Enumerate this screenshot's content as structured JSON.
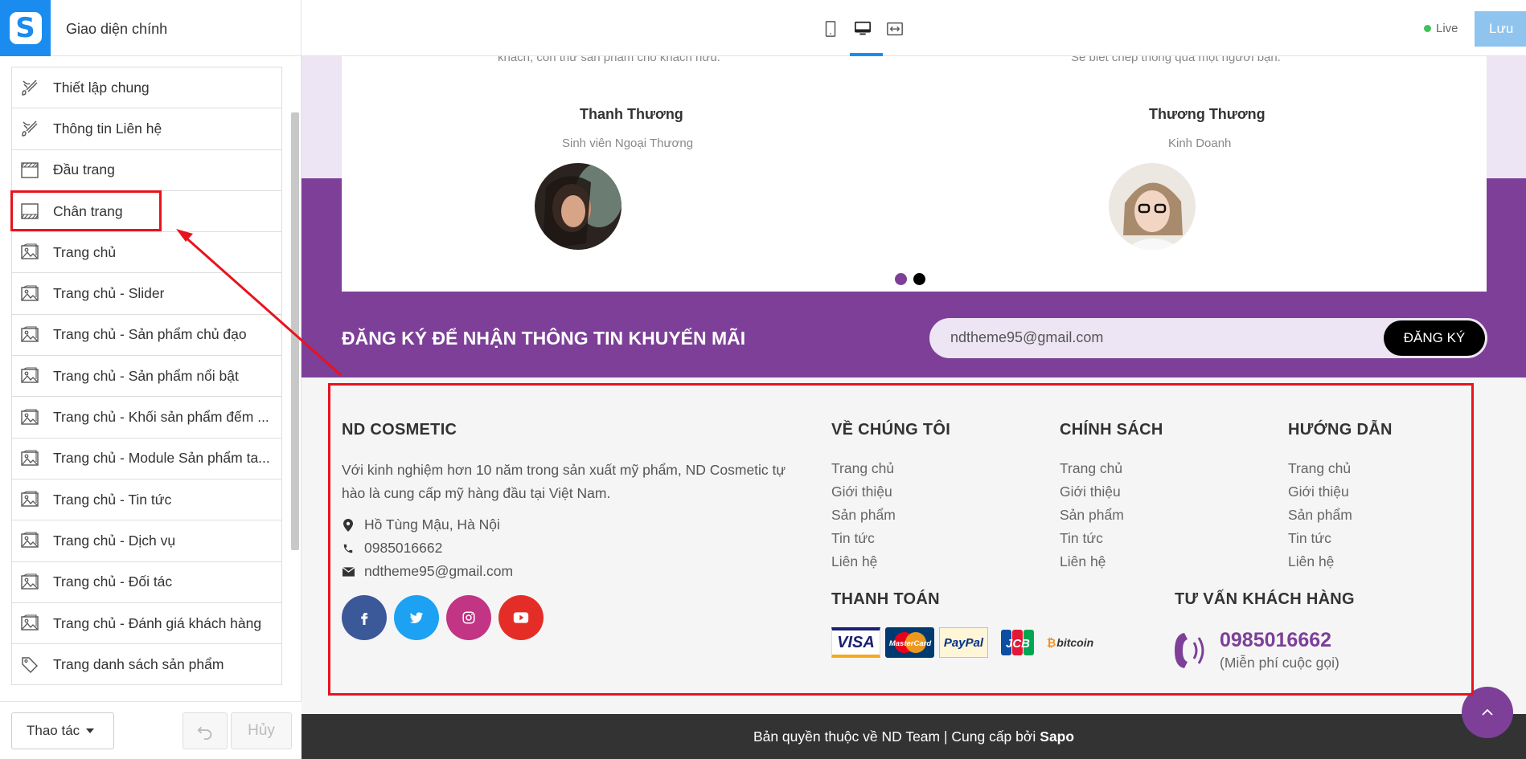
{
  "topbar": {
    "title": "Giao diện chính",
    "logo_letter": "S",
    "devices": [
      "mobile-icon",
      "desktop-icon",
      "fullwidth-icon"
    ],
    "active_device": "desktop",
    "live_label": "Live",
    "save_label": "Lưu"
  },
  "sidebar": {
    "items": [
      {
        "label": "Thiết lập chung",
        "icon": "brush-icon"
      },
      {
        "label": "Thông tin Liên hệ",
        "icon": "brush-icon"
      },
      {
        "label": "Đầu trang",
        "icon": "header-icon"
      },
      {
        "label": "Chân trang",
        "icon": "footer-icon"
      },
      {
        "label": "Trang chủ",
        "icon": "image-icon"
      },
      {
        "label": "Trang chủ - Slider",
        "icon": "image-icon"
      },
      {
        "label": "Trang chủ - Sản phẩm chủ đạo",
        "icon": "image-icon"
      },
      {
        "label": "Trang chủ - Sản phẩm nổi bật",
        "icon": "image-icon"
      },
      {
        "label": "Trang chủ - Khối sản phẩm đếm ...",
        "icon": "image-icon"
      },
      {
        "label": "Trang chủ - Module Sản phẩm ta...",
        "icon": "image-icon"
      },
      {
        "label": "Trang chủ - Tin tức",
        "icon": "image-icon"
      },
      {
        "label": "Trang chủ - Dịch vụ",
        "icon": "image-icon"
      },
      {
        "label": "Trang chủ - Đối tác",
        "icon": "image-icon"
      },
      {
        "label": "Trang chủ - Đánh giá khách hàng",
        "icon": "image-icon"
      },
      {
        "label": "Trang danh sách sản phẩm",
        "icon": "tag-icon"
      }
    ],
    "highlighted_item": "Chân trang",
    "action_label": "Thao tác",
    "cancel_label": "Hủy"
  },
  "preview": {
    "testimonials": {
      "cut_text_left": "khách, còn thử sản phẩm cho khách hữu.",
      "cut_text_right": "Sẽ biết chép thông qua một người bạn.",
      "people": [
        {
          "name": "Thanh Thương",
          "role": "Sinh viên Ngoại Thương"
        },
        {
          "name": "Thương Thương",
          "role": "Kinh Doanh"
        }
      ],
      "active_dot": 1
    },
    "newsletter": {
      "title": "ĐĂNG KÝ ĐỂ NHẬN THÔNG TIN KHUYẾN MÃI",
      "email_value": "ndtheme95@gmail.com",
      "button_label": "ĐĂNG KÝ"
    },
    "footer": {
      "brand": "ND COSMETIC",
      "description": "Với kinh nghiệm hơn 10 năm trong sản xuất mỹ phẩm, ND Cosmetic tự hào là cung cấp mỹ hàng đầu tại Việt Nam.",
      "address": "Hồ Tùng Mậu, Hà Nội",
      "phone": "0985016662",
      "email": "ndtheme95@gmail.com",
      "social": [
        "facebook-icon",
        "twitter-icon",
        "instagram-icon",
        "youtube-icon"
      ],
      "columns": [
        {
          "title": "VỀ CHÚNG TÔI",
          "links": [
            "Trang chủ",
            "Giới thiệu",
            "Sản phẩm",
            "Tin tức",
            "Liên hệ"
          ]
        },
        {
          "title": "CHÍNH SÁCH",
          "links": [
            "Trang chủ",
            "Giới thiệu",
            "Sản phẩm",
            "Tin tức",
            "Liên hệ"
          ]
        },
        {
          "title": "HƯỚNG DẪN",
          "links": [
            "Trang chủ",
            "Giới thiệu",
            "Sản phẩm",
            "Tin tức",
            "Liên hệ"
          ]
        }
      ],
      "payment_title": "THANH TOÁN",
      "payment_logos": [
        "VISA",
        "MasterCard",
        "PayPal",
        "JCB",
        "bitcoin"
      ],
      "support_title": "TƯ VẤN KHÁCH HÀNG",
      "hotline": "0985016662",
      "hotline_note": "(Miễn phí cuộc gọi)"
    },
    "copyright_text": "Bản quyền thuộc về ND Team | Cung cấp bởi",
    "copyright_brand": "Sapo"
  },
  "colors": {
    "brand_purple": "#7d3f98",
    "light_purple": "#ede5f3",
    "sapo_blue": "#1a8cf0",
    "annotation_red": "#e8131d"
  }
}
